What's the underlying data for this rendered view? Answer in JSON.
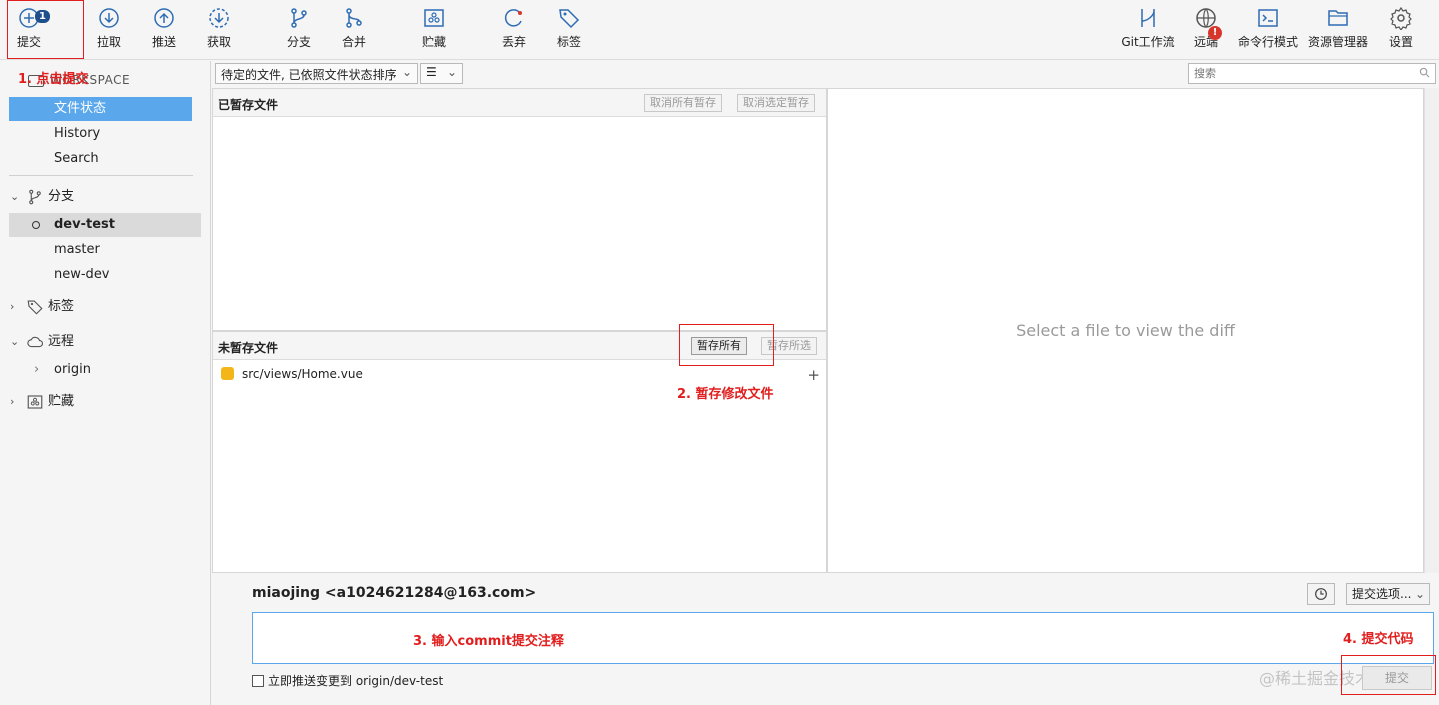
{
  "toolbar": {
    "items": [
      {
        "label": "提交",
        "icon": "plus-circle-icon",
        "badge": "1"
      },
      {
        "label": "拉取",
        "icon": "arrow-down-circle-icon"
      },
      {
        "label": "推送",
        "icon": "arrow-up-circle-icon"
      },
      {
        "label": "获取",
        "icon": "fetch-dashed-circle-icon"
      },
      {
        "label": "分支",
        "icon": "branch-icon"
      },
      {
        "label": "合并",
        "icon": "merge-icon"
      },
      {
        "label": "贮藏",
        "icon": "stash-icon"
      },
      {
        "label": "丢弃",
        "icon": "discard-icon"
      },
      {
        "label": "标签",
        "icon": "tag-icon"
      },
      {
        "label": "Git工作流",
        "icon": "git-flow-icon"
      },
      {
        "label": "远端",
        "icon": "globe-icon",
        "badge": "!"
      },
      {
        "label": "命令行模式",
        "icon": "terminal-icon"
      },
      {
        "label": "资源管理器",
        "icon": "folder-icon"
      },
      {
        "label": "设置",
        "icon": "gear-icon"
      }
    ]
  },
  "sidebar": {
    "workspace_label": "WORKSPACE",
    "workspace_items": [
      "文件状态",
      "History",
      "Search"
    ],
    "branches_label": "分支",
    "branches": [
      "dev-test",
      "master",
      "new-dev"
    ],
    "tags_label": "标签",
    "remotes_label": "远程",
    "remotes": [
      "origin"
    ],
    "stash_label": "贮藏"
  },
  "filter": {
    "sort_value": "待定的文件, 已依照文件状态排序",
    "view_value": "☰",
    "search_placeholder": "搜索"
  },
  "staged": {
    "title": "已暂存文件",
    "unstage_all": "取消所有暂存",
    "unstage_selected": "取消选定暂存"
  },
  "unstaged": {
    "title": "未暂存文件",
    "stage_all": "暂存所有",
    "stage_selected": "暂存所选",
    "files": [
      "src/views/Home.vue"
    ]
  },
  "diff": {
    "placeholder": "Select a file to view the diff"
  },
  "commit": {
    "author": "miaojing <a1024621284@163.com>",
    "options_label": "提交选项...",
    "push_label": "立即推送变更到 origin/dev-test",
    "commit_button": "提交",
    "watermark": "@稀土掘金技术社区"
  },
  "annotations": {
    "step1": "1. 点击提交",
    "step2": "2. 暂存修改文件",
    "step3": "3. 输入commit提交注释",
    "step4": "4. 提交代码"
  },
  "colors": {
    "annotation": "#e11d1d",
    "selection": "#5aa7ec",
    "badge": "#1f4e8c"
  }
}
